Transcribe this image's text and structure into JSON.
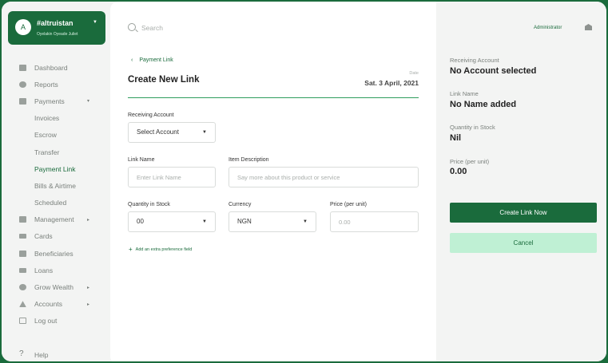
{
  "account": {
    "avatar": "A",
    "name": "#altruistan",
    "owner": "Oyelakin Oyeade Juliet"
  },
  "nav": {
    "items": [
      {
        "label": "Dashboard",
        "icon": "document-icon"
      },
      {
        "label": "Reports",
        "icon": "pie-chart-icon"
      },
      {
        "label": "Payments",
        "icon": "wallet-icon"
      },
      {
        "label": "Invoices"
      },
      {
        "label": "Escrow"
      },
      {
        "label": "Transfer"
      },
      {
        "label": "Payment Link"
      },
      {
        "label": "Bills & Airtime"
      },
      {
        "label": "Scheduled"
      },
      {
        "label": "Management",
        "icon": "grid-icon"
      },
      {
        "label": "Cards",
        "icon": "card-icon"
      },
      {
        "label": "Beneficiaries",
        "icon": "bank-icon"
      },
      {
        "label": "Loans",
        "icon": "cash-icon"
      },
      {
        "label": "Grow Wealth",
        "icon": "growth-icon"
      },
      {
        "label": "Accounts",
        "icon": "user-icon"
      },
      {
        "label": "Log out",
        "icon": "logout-icon"
      }
    ],
    "help": "Help"
  },
  "search": {
    "placeholder": "Search"
  },
  "form": {
    "back_label": "Payment Link",
    "title": "Create New Link",
    "date_label": "Date",
    "date_value": "Sat. 3 April, 2021",
    "receiving_account_label": "Receiving Account",
    "receiving_account_value": "Select Account",
    "link_name_label": "Link Name",
    "link_name_placeholder": "Enter Link Name",
    "description_label": "Item Description",
    "description_placeholder": "Say more about this product or service",
    "quantity_label": "Quantity in Stock",
    "quantity_value": "00",
    "currency_label": "Currency",
    "currency_value": "NGN",
    "price_label": "Price (per unit)",
    "price_placeholder": "0.00",
    "add_field_label": "Add an extra preference field"
  },
  "summary": {
    "role": "Administrator",
    "receiving_account_label": "Receiving Account",
    "receiving_account_value": "No Account selected",
    "link_name_label": "Link Name",
    "link_name_value": "No Name added",
    "quantity_label": "Quantity in Stock",
    "quantity_value": "Nil",
    "price_label": "Price (per unit)",
    "price_value": "0.00",
    "create_button": "Create Link Now",
    "cancel_button": "Cancel"
  },
  "colors": {
    "brand": "#1a6b3c",
    "cancel_bg": "#bff0d4"
  }
}
